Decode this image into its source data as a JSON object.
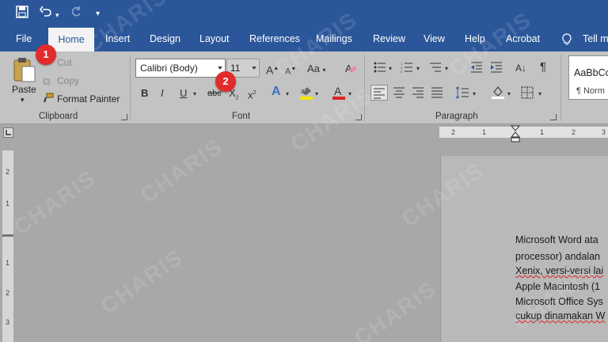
{
  "titlebar": {
    "save_icon": "save-icon",
    "undo_icon": "undo-icon",
    "redo_icon": "redo-icon",
    "customize_icon": "chevron-down-icon"
  },
  "tabs": [
    {
      "label": "File"
    },
    {
      "label": "Home"
    },
    {
      "label": "Insert"
    },
    {
      "label": "Design"
    },
    {
      "label": "Layout"
    },
    {
      "label": "References"
    },
    {
      "label": "Mailings"
    },
    {
      "label": "Review"
    },
    {
      "label": "View"
    },
    {
      "label": "Help"
    },
    {
      "label": "Acrobat"
    },
    {
      "label": "Tell m"
    }
  ],
  "clipboard": {
    "paste_label": "Paste",
    "cut_label": "Cut",
    "copy_label": "Copy",
    "format_painter_label": "Format Painter",
    "group_label": "Clipboard"
  },
  "font": {
    "font_name": "Calibri (Body)",
    "font_size": "11",
    "grow_label": "A",
    "case_label": "Aa",
    "bold_label": "B",
    "italic_label": "I",
    "underline_label": "U",
    "strike_label": "abc",
    "subscript_label": "X",
    "superscript_label": "x",
    "group_label": "Font"
  },
  "paragraph": {
    "pilcrow_label": "¶",
    "group_label": "Paragraph"
  },
  "styles": {
    "preview_label": "AaBbCc",
    "normal_label": "¶ Norm"
  },
  "annotations": {
    "badge_1": "1",
    "badge_2": "2"
  },
  "ruler": {
    "h_labels": [
      "2",
      "1",
      "1",
      "2",
      "3"
    ],
    "v_labels": [
      "2",
      "1",
      "1",
      "2",
      "3"
    ]
  },
  "document": {
    "lines": [
      "Microsoft Word ata",
      "processor) andalan",
      "Xenix, versi-versi lai",
      "Apple Macintosh (1",
      "Microsoft Office Sys",
      "cukup dinamakan W"
    ]
  },
  "watermark": "CHARIS",
  "colors": {
    "brand": "#2b579a",
    "badge": "#e22b2b",
    "highlight": "#f5e600",
    "font_color": "#d22"
  }
}
